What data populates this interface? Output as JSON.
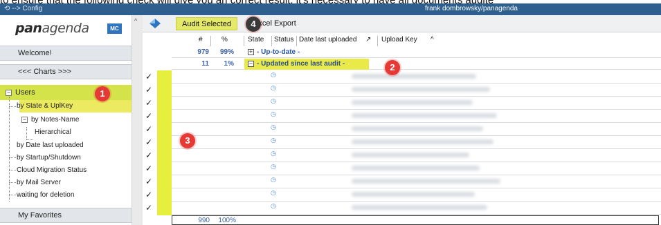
{
  "banner": {
    "text": "to ensure that the following check will give you an correct result, it's necessary to have all documents audite"
  },
  "titlebar": {
    "back_label": "⟲ --> Config",
    "user_path": "frank dombrowsky/panagenda"
  },
  "nav": {
    "logo_text": "panagenda",
    "logo_badge": "MC",
    "welcome": "Welcome!",
    "charts": "<<< Charts >>>",
    "favorites": "My Favorites",
    "tree": [
      {
        "label": "Users"
      },
      {
        "label": "by State & UplKey"
      },
      {
        "label": "by Notes-Name"
      },
      {
        "label": "Hierarchical"
      },
      {
        "label": "by Date last uploaded"
      },
      {
        "label": "by Startup/Shutdown"
      },
      {
        "label": "Cloud Migration Status"
      },
      {
        "label": "by Mail Server"
      },
      {
        "label": "waiting for deletion"
      }
    ]
  },
  "toolbar": {
    "audit_label": "Audit Selected",
    "export_label": "Excel Export"
  },
  "grid": {
    "headers": {
      "count": "#",
      "pct": "%",
      "state": "State",
      "status": "Status",
      "date": "Date last uploaded",
      "upload": "Upload Key"
    },
    "cat1": {
      "count": "979",
      "pct": "99%",
      "label": "- Up-to-date -"
    },
    "cat2": {
      "count": "11",
      "pct": "1%",
      "label": "- Updated since last audit -"
    },
    "total": {
      "count": "990",
      "pct": "100%"
    }
  },
  "callouts": [
    "1",
    "2",
    "3",
    "4"
  ],
  "colors": {
    "highlight": "#e6ee3e",
    "selection": "#d4e34a",
    "title_blue": "#2e5f8e",
    "callout": "#e53935"
  },
  "icons": {
    "check": "check-icon",
    "clock": "clock-icon",
    "expand": "expand-icon",
    "collapse": "collapse-icon"
  }
}
